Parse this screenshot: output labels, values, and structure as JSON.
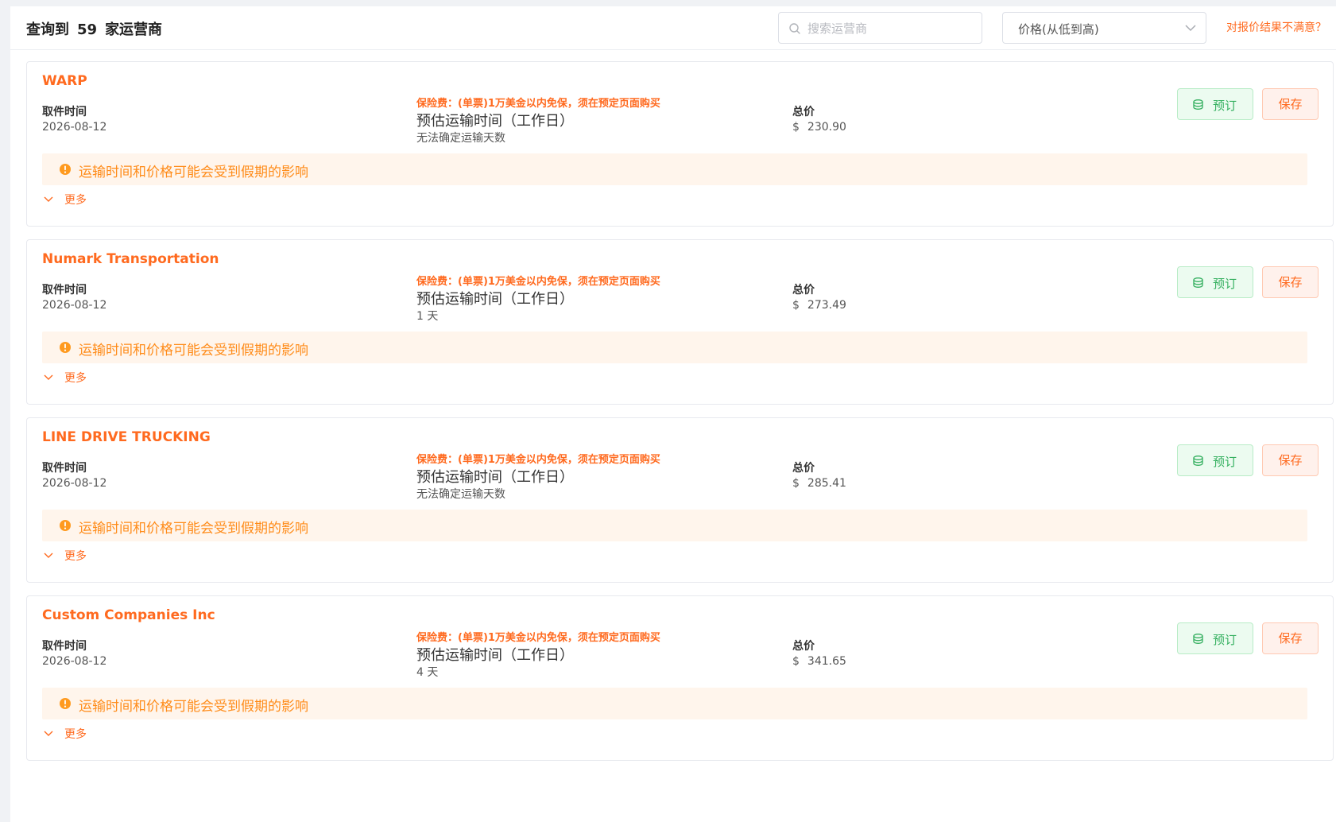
{
  "header": {
    "result_prefix": "查询到",
    "result_count": "59",
    "result_suffix": "家运营商",
    "search_placeholder": "搜索运营商",
    "search_value": "",
    "sort_value": "价格(从低到高)",
    "unsatisfied_link": "对报价结果不满意？"
  },
  "labels": {
    "pickup_label": "取件时间",
    "insurance_note": "保险费：(单票)1万美金以内免保，须在预定页面购买",
    "transit_label": "预估运输时间（工作日）",
    "total_label": "总价",
    "currency": "$",
    "book_label": "预订",
    "save_label": "保存",
    "notice": "运输时间和价格可能会受到假期的影响",
    "more_label": "更多"
  },
  "carriers": [
    {
      "name": "WARP",
      "pickup_date": "2026-08-12",
      "transit_days": "无法确定运输天数",
      "total_price": "230.90"
    },
    {
      "name": "Numark Transportation",
      "pickup_date": "2026-08-12",
      "transit_days": "1 天",
      "total_price": "273.49"
    },
    {
      "name": "LINE DRIVE TRUCKING",
      "pickup_date": "2026-08-12",
      "transit_days": "无法确定运输天数",
      "total_price": "285.41"
    },
    {
      "name": "Custom Companies Inc",
      "pickup_date": "2026-08-12",
      "transit_days": "4 天",
      "total_price": "341.65"
    }
  ],
  "colors": {
    "accent": "#ff6a1f",
    "book_green": "#35b060",
    "notice_bg": "#fff5ec",
    "notice_text": "#ff8c1a"
  }
}
